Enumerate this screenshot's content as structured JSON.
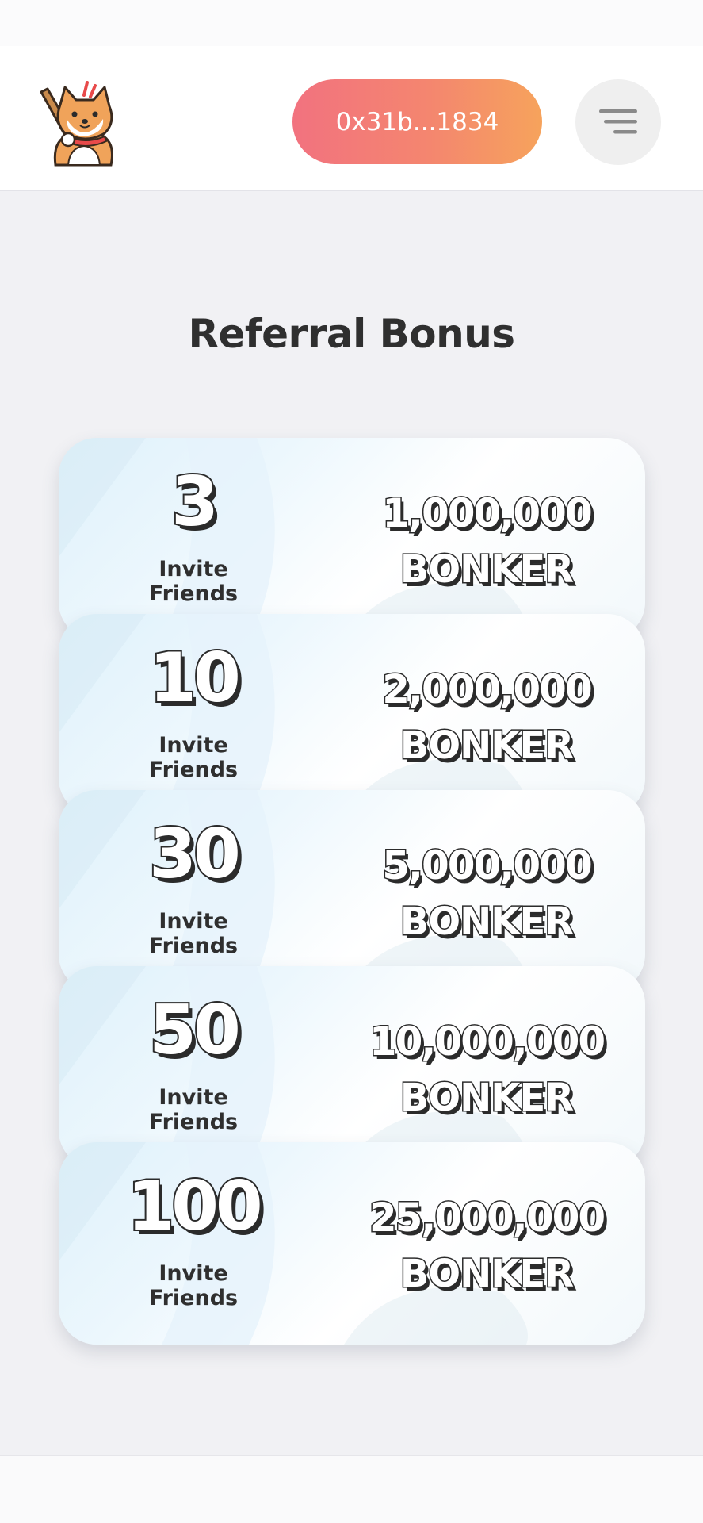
{
  "header": {
    "wallet_label": "0x31b...1834",
    "menu_icon": "menu-icon",
    "logo_icon": "shiba-mascot-logo",
    "accent_gradient": [
      "#f2727f",
      "#f6a35c"
    ]
  },
  "main": {
    "title": "Referral Bonus"
  },
  "tiers": [
    {
      "count": "3",
      "label_line1": "Invite",
      "label_line2": "Friends",
      "amount": "1,000,000",
      "token": "BONKER"
    },
    {
      "count": "10",
      "label_line1": "Invite",
      "label_line2": "Friends",
      "amount": "2,000,000",
      "token": "BONKER"
    },
    {
      "count": "30",
      "label_line1": "Invite",
      "label_line2": "Friends",
      "amount": "5,000,000",
      "token": "BONKER"
    },
    {
      "count": "50",
      "label_line1": "Invite",
      "label_line2": "Friends",
      "amount": "10,000,000",
      "token": "BONKER"
    },
    {
      "count": "100",
      "label_line1": "Invite",
      "label_line2": "Friends",
      "amount": "25,000,000",
      "token": "BONKER"
    }
  ]
}
